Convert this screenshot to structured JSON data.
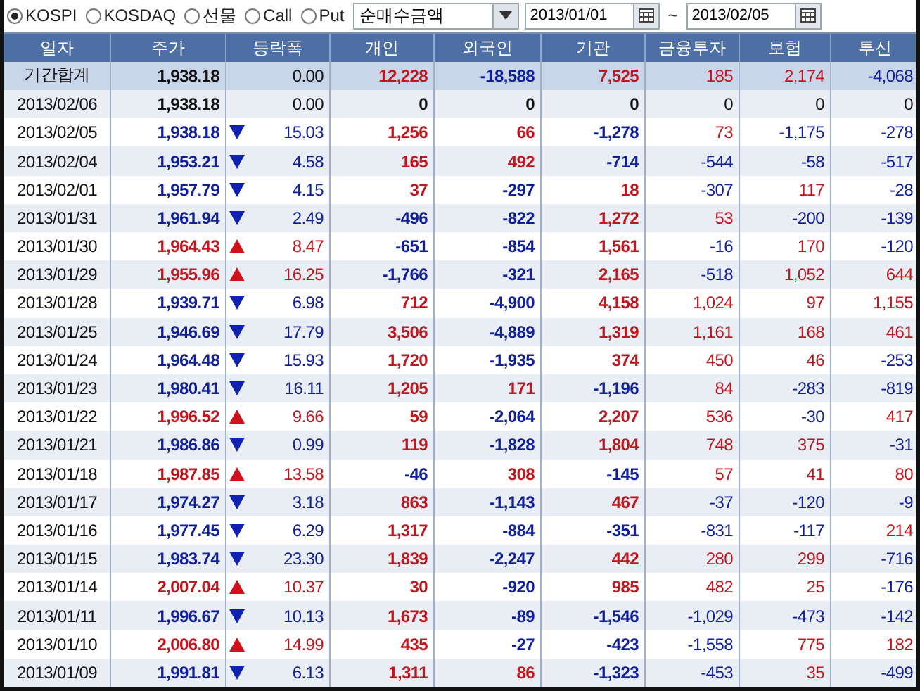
{
  "market_options": [
    {
      "label": "KOSPI",
      "selected": true
    },
    {
      "label": "KOSDAQ",
      "selected": false
    },
    {
      "label": "선물",
      "selected": false
    },
    {
      "label": "Call",
      "selected": false
    },
    {
      "label": "Put",
      "selected": false
    }
  ],
  "measure_select": {
    "value": "순매수금액"
  },
  "date_from": {
    "value": "2013/01/01"
  },
  "range_separator": "~",
  "date_to": {
    "value": "2013/02/05"
  },
  "table": {
    "columns": [
      "일자",
      "주가",
      "등락폭",
      "개인",
      "외국인",
      "기관",
      "금융투자",
      "보험",
      "투신"
    ],
    "rows": [
      {
        "kind": "summary",
        "date": "기간합계",
        "price": "1,938.18",
        "rising": false,
        "falling": false,
        "change": "0.00",
        "values": [
          "12,228",
          "-18,588",
          "7,525",
          "185",
          "2,174",
          "-4,068"
        ]
      },
      {
        "kind": "day",
        "date": "2013/02/06",
        "price": "1,938.18",
        "rising": false,
        "falling": false,
        "change": "0.00",
        "values": [
          "0",
          "0",
          "0",
          "0",
          "0",
          "0"
        ]
      },
      {
        "kind": "day",
        "date": "2013/02/05",
        "price": "1,938.18",
        "rising": false,
        "falling": true,
        "change": "15.03",
        "values": [
          "1,256",
          "66",
          "-1,278",
          "73",
          "-1,175",
          "-278"
        ]
      },
      {
        "kind": "day",
        "date": "2013/02/04",
        "price": "1,953.21",
        "rising": false,
        "falling": true,
        "change": "4.58",
        "values": [
          "165",
          "492",
          "-714",
          "-544",
          "-58",
          "-517"
        ]
      },
      {
        "kind": "day",
        "date": "2013/02/01",
        "price": "1,957.79",
        "rising": false,
        "falling": true,
        "change": "4.15",
        "values": [
          "37",
          "-297",
          "18",
          "-307",
          "117",
          "-28"
        ]
      },
      {
        "kind": "day",
        "date": "2013/01/31",
        "price": "1,961.94",
        "rising": false,
        "falling": true,
        "change": "2.49",
        "values": [
          "-496",
          "-822",
          "1,272",
          "53",
          "-200",
          "-139"
        ]
      },
      {
        "kind": "day",
        "date": "2013/01/30",
        "price": "1,964.43",
        "rising": true,
        "falling": false,
        "change": "8.47",
        "values": [
          "-651",
          "-854",
          "1,561",
          "-16",
          "170",
          "-120"
        ]
      },
      {
        "kind": "day",
        "date": "2013/01/29",
        "price": "1,955.96",
        "rising": true,
        "falling": false,
        "change": "16.25",
        "values": [
          "-1,766",
          "-321",
          "2,165",
          "-518",
          "1,052",
          "644"
        ]
      },
      {
        "kind": "day",
        "date": "2013/01/28",
        "price": "1,939.71",
        "rising": false,
        "falling": true,
        "change": "6.98",
        "values": [
          "712",
          "-4,900",
          "4,158",
          "1,024",
          "97",
          "1,155"
        ]
      },
      {
        "kind": "day",
        "date": "2013/01/25",
        "price": "1,946.69",
        "rising": false,
        "falling": true,
        "change": "17.79",
        "values": [
          "3,506",
          "-4,889",
          "1,319",
          "1,161",
          "168",
          "461"
        ]
      },
      {
        "kind": "day",
        "date": "2013/01/24",
        "price": "1,964.48",
        "rising": false,
        "falling": true,
        "change": "15.93",
        "values": [
          "1,720",
          "-1,935",
          "374",
          "450",
          "46",
          "-253"
        ]
      },
      {
        "kind": "day",
        "date": "2013/01/23",
        "price": "1,980.41",
        "rising": false,
        "falling": true,
        "change": "16.11",
        "values": [
          "1,205",
          "171",
          "-1,196",
          "84",
          "-283",
          "-819"
        ]
      },
      {
        "kind": "day",
        "date": "2013/01/22",
        "price": "1,996.52",
        "rising": true,
        "falling": false,
        "change": "9.66",
        "values": [
          "59",
          "-2,064",
          "2,207",
          "536",
          "-30",
          "417"
        ]
      },
      {
        "kind": "day",
        "date": "2013/01/21",
        "price": "1,986.86",
        "rising": false,
        "falling": true,
        "change": "0.99",
        "values": [
          "119",
          "-1,828",
          "1,804",
          "748",
          "375",
          "-31"
        ]
      },
      {
        "kind": "day",
        "date": "2013/01/18",
        "price": "1,987.85",
        "rising": true,
        "falling": false,
        "change": "13.58",
        "values": [
          "-46",
          "308",
          "-145",
          "57",
          "41",
          "80"
        ]
      },
      {
        "kind": "day",
        "date": "2013/01/17",
        "price": "1,974.27",
        "rising": false,
        "falling": true,
        "change": "3.18",
        "values": [
          "863",
          "-1,143",
          "467",
          "-37",
          "-120",
          "-9"
        ]
      },
      {
        "kind": "day",
        "date": "2013/01/16",
        "price": "1,977.45",
        "rising": false,
        "falling": true,
        "change": "6.29",
        "values": [
          "1,317",
          "-884",
          "-351",
          "-831",
          "-117",
          "214"
        ]
      },
      {
        "kind": "day",
        "date": "2013/01/15",
        "price": "1,983.74",
        "rising": false,
        "falling": true,
        "change": "23.30",
        "values": [
          "1,839",
          "-2,247",
          "442",
          "280",
          "299",
          "-716"
        ]
      },
      {
        "kind": "day",
        "date": "2013/01/14",
        "price": "2,007.04",
        "rising": true,
        "falling": false,
        "change": "10.37",
        "values": [
          "30",
          "-920",
          "985",
          "482",
          "25",
          "-176"
        ]
      },
      {
        "kind": "day",
        "date": "2013/01/11",
        "price": "1,996.67",
        "rising": false,
        "falling": true,
        "change": "10.13",
        "values": [
          "1,673",
          "-89",
          "-1,546",
          "-1,029",
          "-473",
          "-142"
        ]
      },
      {
        "kind": "day",
        "date": "2013/01/10",
        "price": "2,006.80",
        "rising": true,
        "falling": false,
        "change": "14.99",
        "values": [
          "435",
          "-27",
          "-423",
          "-1,558",
          "775",
          "182"
        ]
      },
      {
        "kind": "day",
        "date": "2013/01/09",
        "price": "1,991.81",
        "rising": false,
        "falling": true,
        "change": "6.13",
        "values": [
          "1,311",
          "86",
          "-1,323",
          "-453",
          "35",
          "-499"
        ]
      }
    ]
  }
}
